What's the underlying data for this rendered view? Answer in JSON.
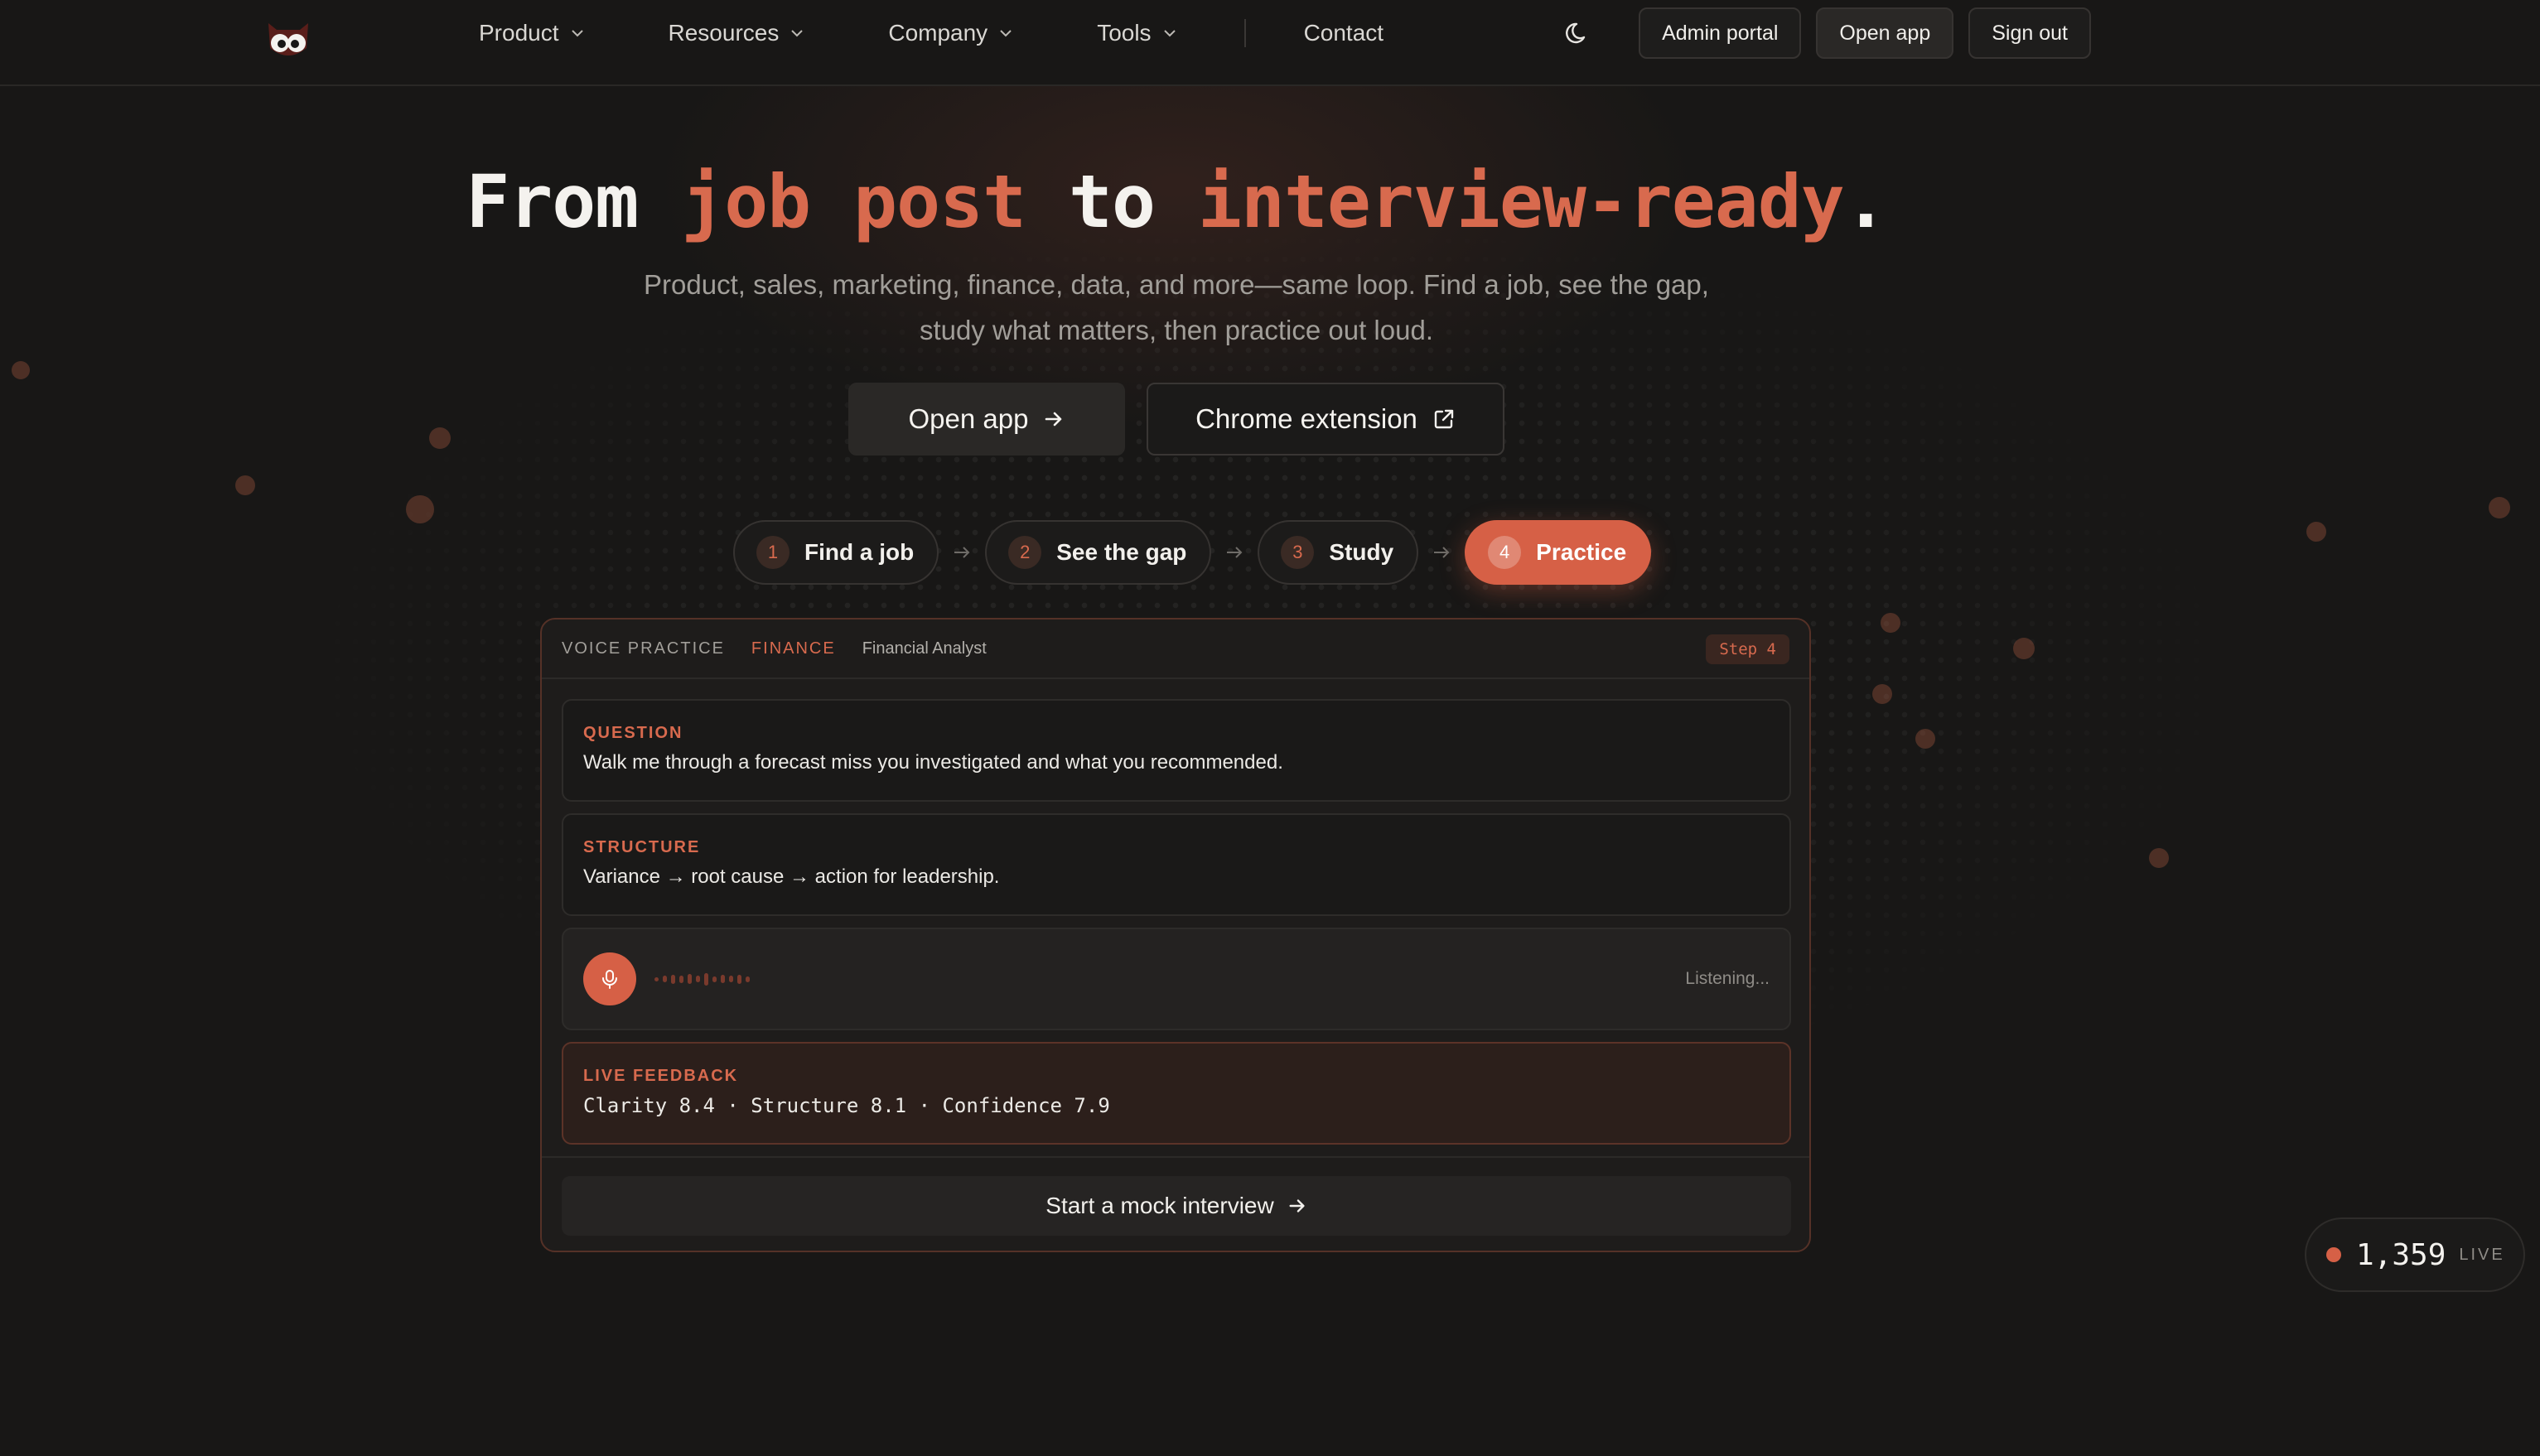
{
  "nav": {
    "menu": [
      {
        "label": "Product"
      },
      {
        "label": "Resources"
      },
      {
        "label": "Company"
      },
      {
        "label": "Tools"
      }
    ],
    "contact": "Contact",
    "buttons": {
      "admin": "Admin portal",
      "open_app": "Open app",
      "sign_out": "Sign out"
    }
  },
  "hero": {
    "title_parts": [
      "From ",
      "job post",
      " to ",
      "interview-ready",
      "."
    ],
    "subtitle_line1": "Product, sales, marketing, finance, data, and more—same loop. Find a job, see the gap,",
    "subtitle_line2": "study what matters, then practice out loud.",
    "primary_button": "Open app",
    "secondary_button": "Chrome extension"
  },
  "steps": [
    {
      "num": "1",
      "label": "Find a job",
      "active": false
    },
    {
      "num": "2",
      "label": "See the gap",
      "active": false
    },
    {
      "num": "3",
      "label": "Study",
      "active": false
    },
    {
      "num": "4",
      "label": "Practice",
      "active": true
    }
  ],
  "card": {
    "kicker": "VOICE PRACTICE",
    "category": "FINANCE",
    "role": "Financial Analyst",
    "step_badge": "Step 4",
    "question_label": "QUESTION",
    "question_text": "Walk me through a forecast miss you investigated and what you recommended.",
    "structure_label": "STRUCTURE",
    "structure_text": "Variance → root cause → action for leadership.",
    "listening": "Listening...",
    "feedback_label": "LIVE FEEDBACK",
    "feedback_text": "Clarity 8.4 · Structure 8.1 · Confidence 7.9",
    "cta": "Start a mock interview"
  },
  "live": {
    "count": "1,359",
    "label": "LIVE"
  },
  "colors": {
    "accent": "#d66046",
    "background": "#181716"
  }
}
